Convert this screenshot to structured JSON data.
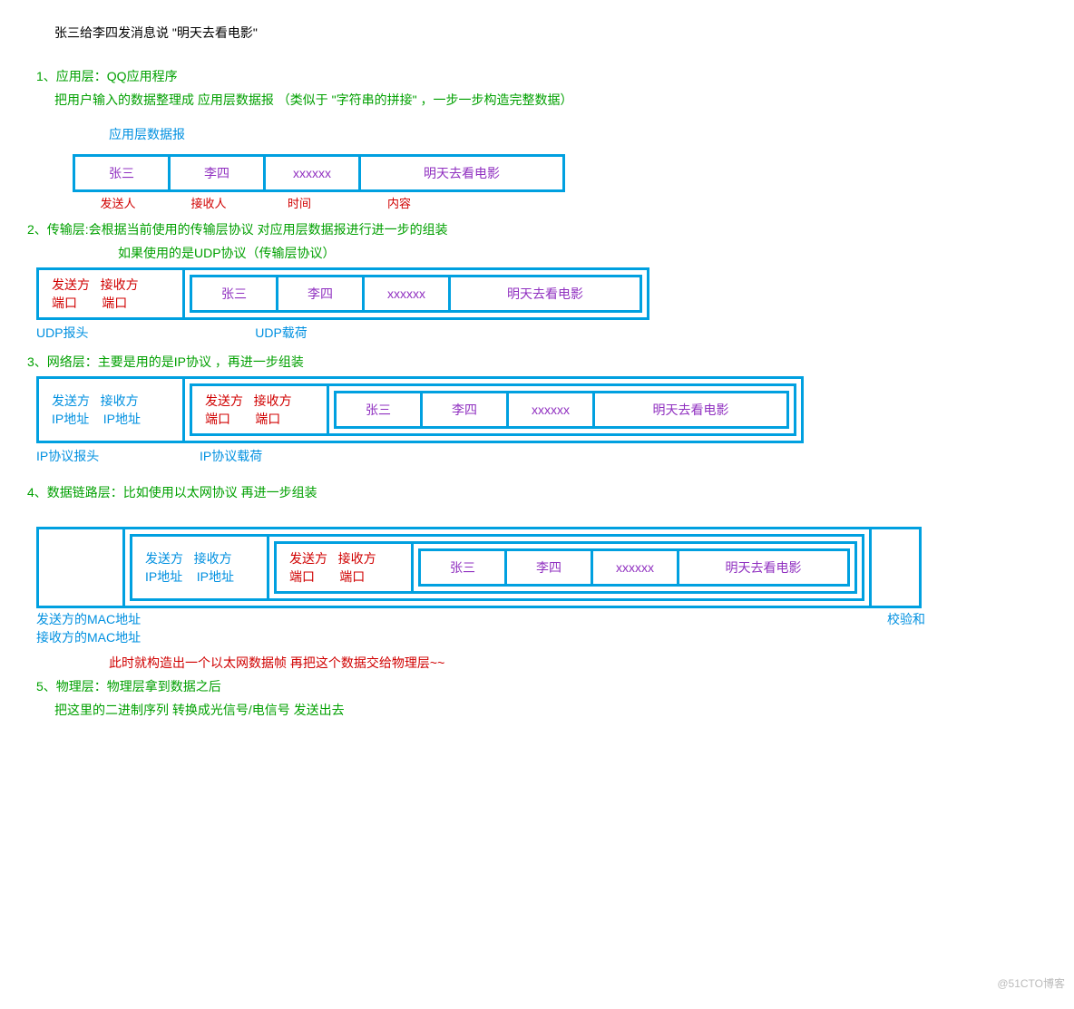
{
  "intro": "张三给李四发消息说  \"明天去看电影\"",
  "layers": {
    "app": {
      "title": "1、应用层：QQ应用程序",
      "sub": "把用户输入的数据整理成 应用层数据报  （类似于  \"字符串的拼接\"  ，一步一步构造完整数据）",
      "pkt_label": "应用层数据报",
      "cells": [
        "张三",
        "李四",
        "xxxxxx",
        "明天去看电影"
      ],
      "col_labels": [
        "发送人",
        "接收人",
        "时间",
        "内容"
      ]
    },
    "trans": {
      "title": "2、传输层:会根据当前使用的传输层协议  对应用层数据报进行进一步的组装",
      "sub": "如果使用的是UDP协议（传输层协议）",
      "hdr": [
        "发送方",
        "接收方",
        "端口",
        "端口"
      ],
      "cap_head": "UDP报头",
      "cap_payload": "UDP载荷"
    },
    "net": {
      "title": "3、网络层：主要是用的是IP协议  ，再进一步组装",
      "hdr": [
        "发送方",
        "接收方",
        "IP地址",
        "IP地址"
      ],
      "cap_head": "IP协议报头",
      "cap_payload": "IP协议载荷"
    },
    "link": {
      "title": "4、数据链路层：比如使用以太网协议  再进一步组装",
      "cap_left1": "发送方的MAC地址",
      "cap_left2": "接收方的MAC地址",
      "cap_right": "校验和",
      "note": "此时就构造出一个以太网数据帧  再把这个数据交给物理层~~"
    },
    "phy": {
      "title": "5、物理层：物理层拿到数据之后",
      "sub": "把这里的二进制序列 转换成光信号/电信号  发送出去"
    }
  },
  "inner": {
    "c1": "张三",
    "c2": "李四",
    "c3": "xxxxxx",
    "c4": "明天去看电影"
  },
  "watermark": "@51CTO博客"
}
